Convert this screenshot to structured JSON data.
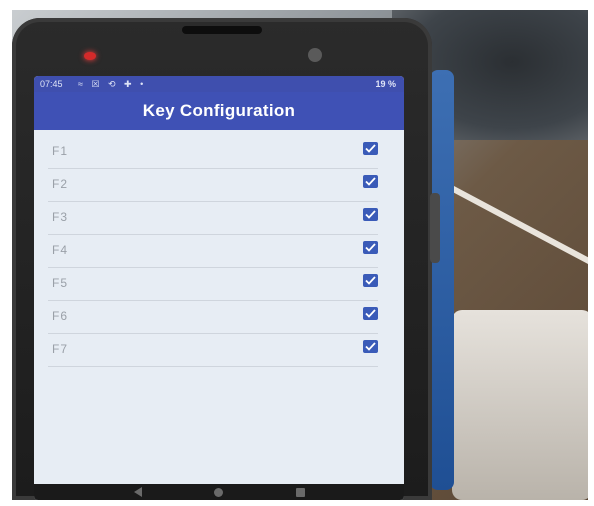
{
  "status_bar": {
    "time": "07:45",
    "icons": "≈ ☒ ⟲ ✚ •",
    "battery": "19 %"
  },
  "app_bar": {
    "title": "Key Configuration"
  },
  "keys": [
    {
      "label": "F1",
      "checked": true
    },
    {
      "label": "F2",
      "checked": true
    },
    {
      "label": "F3",
      "checked": true
    },
    {
      "label": "F4",
      "checked": true
    },
    {
      "label": "F5",
      "checked": true
    },
    {
      "label": "F6",
      "checked": true
    },
    {
      "label": "F7",
      "checked": true
    }
  ],
  "colors": {
    "app_bar": "#3f51b5",
    "checkbox": "#3a5bb8",
    "screen_bg": "#e7edf4"
  }
}
